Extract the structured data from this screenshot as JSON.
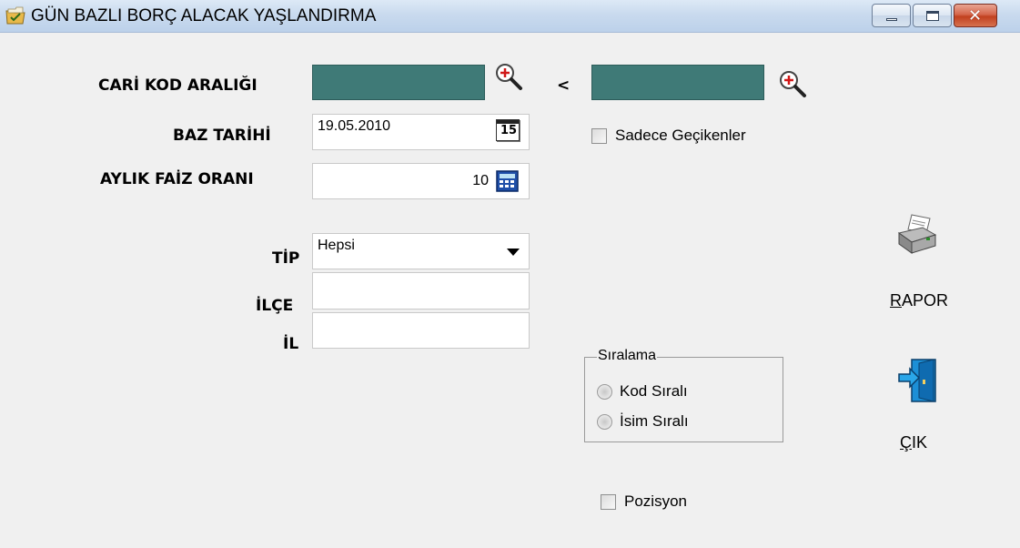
{
  "window": {
    "title": "GÜN BAZLI BORÇ ALACAK YAŞLANDIRMA",
    "icon": "folder-check-icon",
    "controls": [
      "minimize",
      "maximize",
      "close"
    ],
    "close_glyph": "✕"
  },
  "form": {
    "cari_kod_label": "CARİ KOD ARALIĞI",
    "cari_kod_from": "",
    "cari_kod_to": "",
    "range_separator": "<",
    "baz_tarihi_label": "BAZ TARİHİ",
    "baz_tarihi_value": "19.05.2010",
    "calendar_glyph": "15",
    "aylik_faiz_label": "AYLIK FAİZ ORANI",
    "aylik_faiz_value": "10",
    "tip_label": "TİP",
    "tip_value": "Hepsi",
    "ilce_label": "İLÇE",
    "ilce_value": "",
    "il_label": "İL",
    "il_value": ""
  },
  "options": {
    "sadece_gecikenler_label": "Sadece Geçikenler",
    "sadece_gecikenler_checked": false,
    "siralama_title": "Sıralama",
    "kod_sirali_label": "Kod Sıralı",
    "isim_sirali_label": "İsim Sıralı",
    "pozisyon_label": "Pozisyon",
    "pozisyon_checked": false
  },
  "actions": {
    "rapor_hotkey": "R",
    "rapor_rest": "APOR",
    "cik_hotkey": "Ç",
    "cik_rest": "IK"
  },
  "colors": {
    "teal_field": "#3f7a77",
    "window_bg": "#f0f0f0",
    "titlebar": "#c9daee"
  }
}
